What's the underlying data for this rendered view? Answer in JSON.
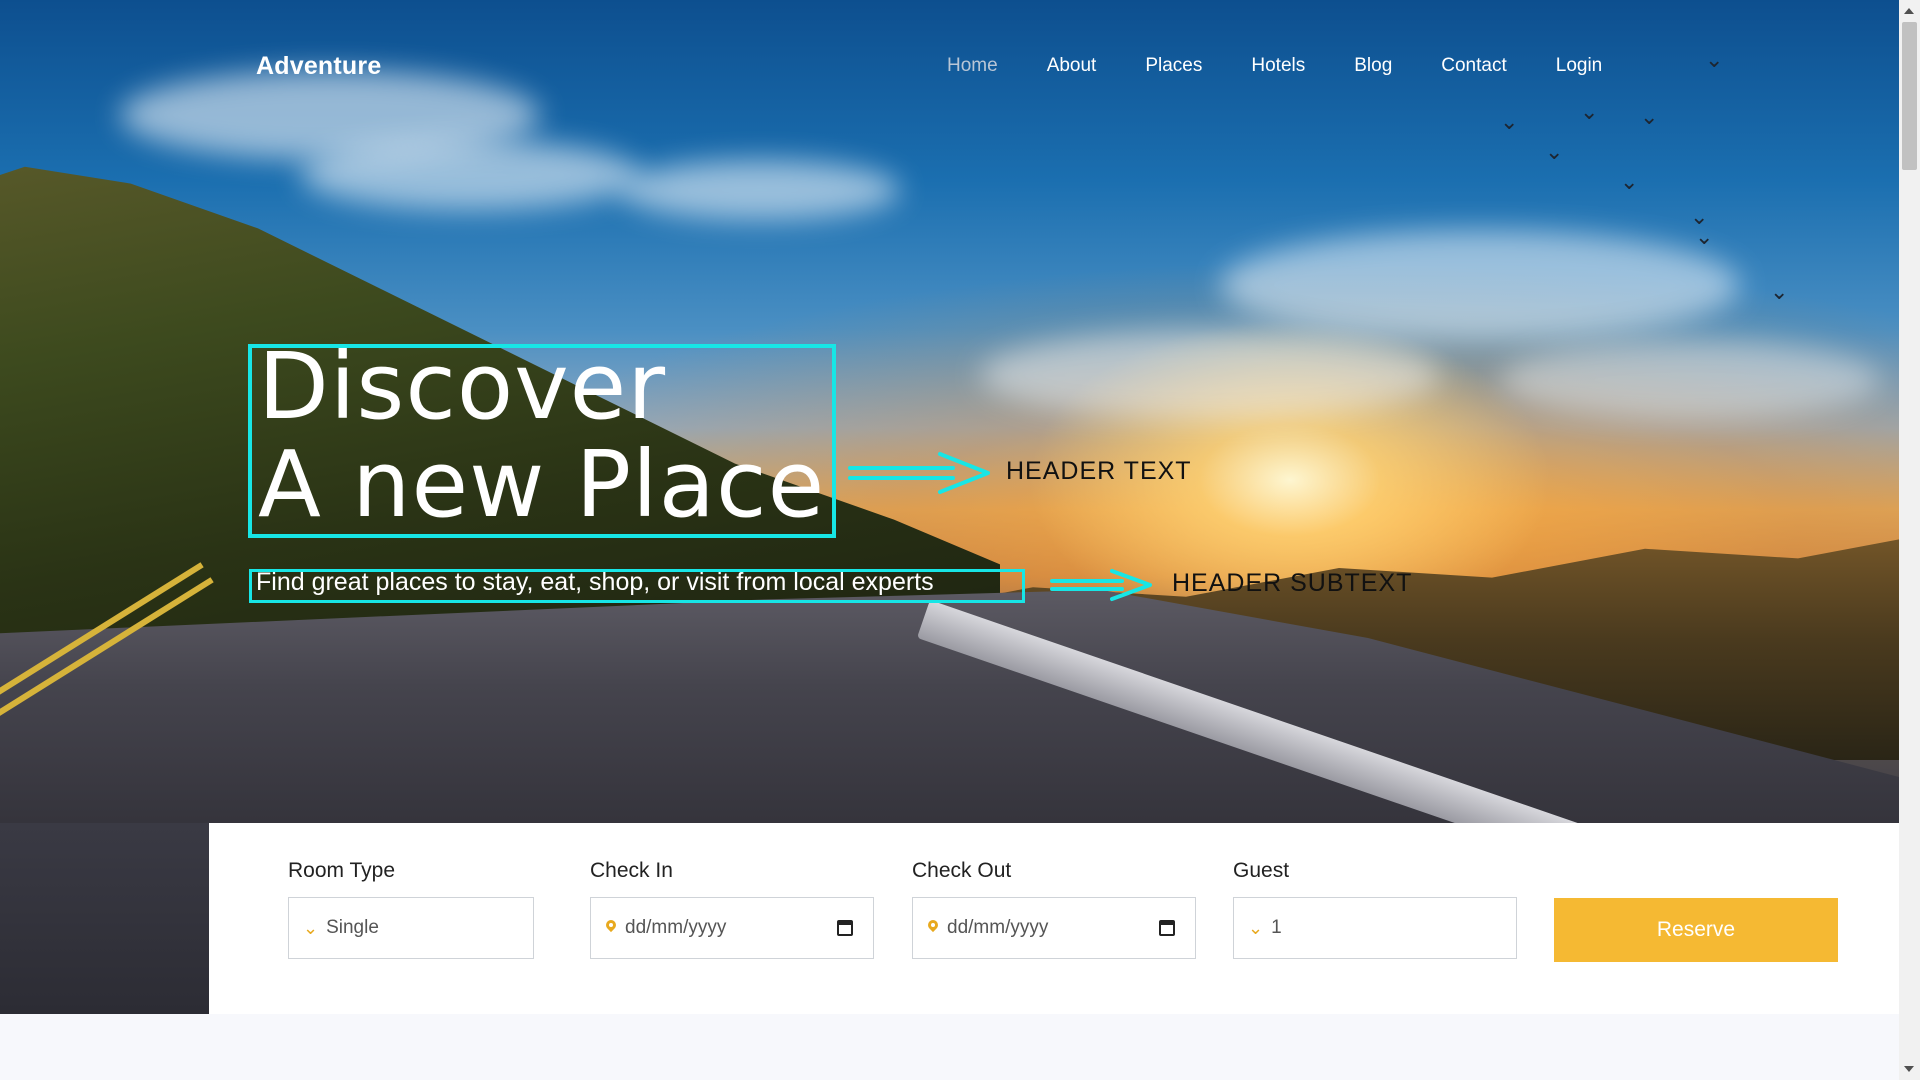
{
  "brand": "Adventure",
  "nav": {
    "items": [
      {
        "label": "Home",
        "active": true
      },
      {
        "label": "About"
      },
      {
        "label": "Places"
      },
      {
        "label": "Hotels"
      },
      {
        "label": "Blog"
      },
      {
        "label": "Contact"
      },
      {
        "label": "Login"
      }
    ]
  },
  "hero": {
    "title_line1": "Discover",
    "title_line2": "A new Place",
    "subtitle": "Find great places to stay, eat, shop, or visit from local experts",
    "annotation_header": "HEADER TEXT",
    "annotation_subheader": "HEADER SUBTEXT",
    "annotation_color": "#17e6e6"
  },
  "booking": {
    "room_type": {
      "label": "Room Type",
      "value": "Single",
      "icon": "chevron-down-icon"
    },
    "check_in": {
      "label": "Check In",
      "value": "dd/mm/yyyy",
      "icon": "map-pin-icon"
    },
    "check_out": {
      "label": "Check Out",
      "value": "dd/mm/yyyy",
      "icon": "map-pin-icon"
    },
    "guest": {
      "label": "Guest",
      "value": "1",
      "icon": "chevron-down-icon"
    },
    "reserve_label": "Reserve",
    "accent_color": "#f5b933"
  }
}
